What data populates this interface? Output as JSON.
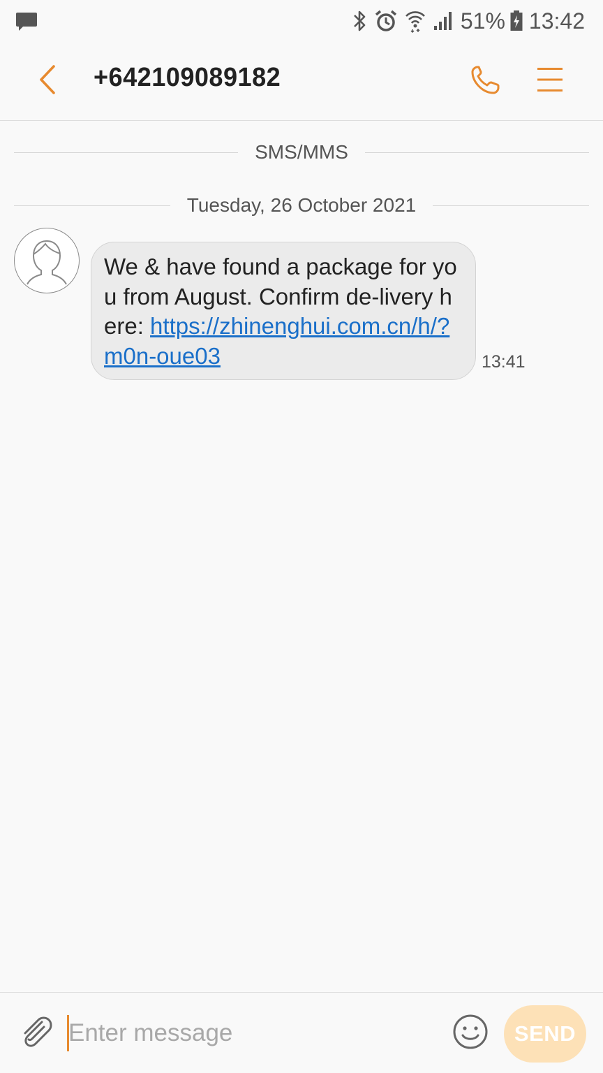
{
  "status_bar": {
    "battery_percent": "51%",
    "clock": "13:42",
    "icons": [
      "message-notification-icon",
      "bluetooth-icon",
      "alarm-icon",
      "wifi-icon",
      "signal-icon",
      "battery-charging-icon"
    ]
  },
  "header": {
    "title": "+642109089182",
    "back_icon": "chevron-left-icon",
    "call_icon": "phone-icon",
    "menu_icon": "hamburger-menu-icon"
  },
  "conversation": {
    "channel_label": "SMS/MMS",
    "date_label": "Tuesday, 26 October 2021",
    "messages": [
      {
        "text_before_link": "We & have found a package for you from  August. Confirm de-livery here: ",
        "link": "https://zhinenghui.com.cn/h/?m0n-oue03",
        "time": "13:41",
        "avatar_icon": "default-contact-avatar-icon"
      }
    ]
  },
  "composer": {
    "placeholder": "Enter message",
    "value": "",
    "send_label": "SEND",
    "attach_icon": "paperclip-icon",
    "emoji_icon": "smiley-icon"
  },
  "colors": {
    "accent": "#e78a2f",
    "link": "#1a6fc9",
    "bubble": "#ebebeb",
    "send_disabled": "#fde1b7",
    "background": "#f9f9f9"
  }
}
